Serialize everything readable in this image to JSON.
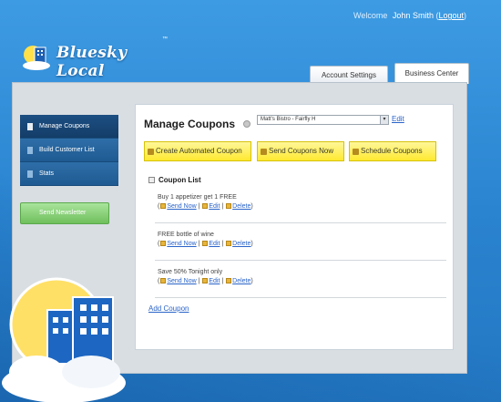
{
  "header": {
    "welcome_label": "Welcome",
    "user_name": "John Smith",
    "logout_label": "Logout",
    "logo_text": "Bluesky Local",
    "logo_tm": "™"
  },
  "tabs": [
    {
      "label": "Account Settings",
      "active": false
    },
    {
      "label": "Business Center",
      "active": true
    }
  ],
  "sidebar": {
    "items": [
      {
        "label": "Manage Coupons",
        "active": true
      },
      {
        "label": "Build Customer List",
        "active": false
      },
      {
        "label": "Stats",
        "active": false
      }
    ],
    "green_button_label": "Send Newsletter"
  },
  "main": {
    "title": "Manage Coupons",
    "business_select_value": "Matt's Bistro - Fairfly H",
    "edit_label": "Edit",
    "buttons": {
      "create_automated": "Create Automated Coupon",
      "send_now": "Send Coupons Now",
      "schedule": "Schedule Coupons"
    },
    "coupon_list_label": "Coupon List",
    "coupons": [
      {
        "name": "Buy 1 appetizer get 1 FREE"
      },
      {
        "name": "FREE bottle of wine"
      },
      {
        "name": "Save 50% Tonight only"
      }
    ],
    "actions": {
      "send_now": "Send Now",
      "edit": "Edit",
      "delete": "Delete"
    },
    "add_coupon_label": "Add Coupon"
  },
  "colors": {
    "background_blue": "#2a86d0",
    "sidebar_blue": "#1f5a92",
    "yellow_button": "#ffe930",
    "green_button": "#6fbf5c",
    "link_blue": "#2a64c8"
  }
}
